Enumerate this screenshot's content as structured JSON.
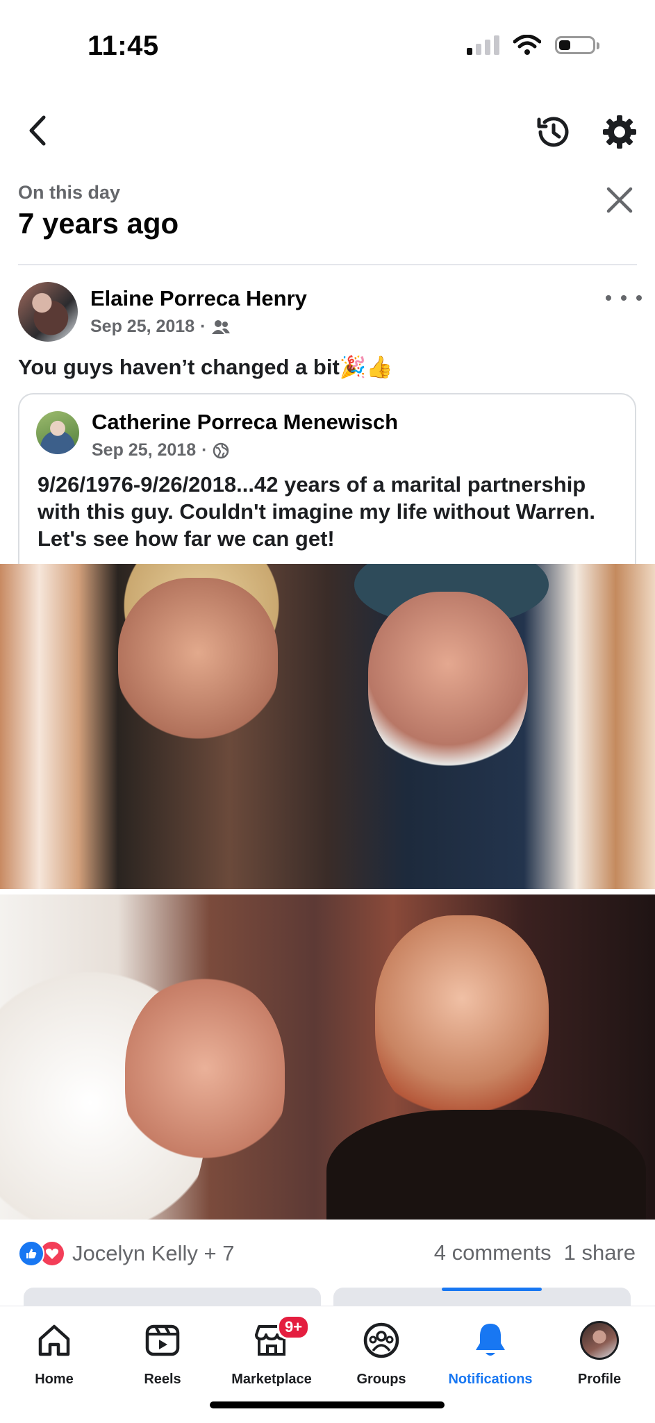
{
  "status_bar": {
    "time": "11:45"
  },
  "memory": {
    "label": "On this day",
    "title": "7 years ago"
  },
  "post": {
    "author": "Elaine Porreca Henry",
    "date": "Sep 25, 2018",
    "separator": "·",
    "audience_icon": "friends-icon",
    "text": "You guys haven’t changed a bit🎉👍"
  },
  "shared_post": {
    "author": "Catherine Porreca Menewisch",
    "date": "Sep 25, 2018",
    "separator": "·",
    "audience_icon": "globe-icon",
    "text": "9/26/1976-9/26/2018...42 years of a marital partnership with this guy. Couldn't imagine my life without Warren. Let's see how far we can get!"
  },
  "engagement": {
    "reactors": "Jocelyn Kelly + 7",
    "comments": "4 comments",
    "shares": "1 share"
  },
  "tabs": [
    {
      "label": "Home",
      "icon": "home-icon"
    },
    {
      "label": "Reels",
      "icon": "reels-icon"
    },
    {
      "label": "Marketplace",
      "icon": "marketplace-icon",
      "badge": "9+"
    },
    {
      "label": "Groups",
      "icon": "groups-icon"
    },
    {
      "label": "Notifications",
      "icon": "bell-icon",
      "active": true
    },
    {
      "label": "Profile",
      "icon": "profile-avatar"
    }
  ],
  "colors": {
    "accent": "#1877f2",
    "badge": "#e41e3f",
    "love": "#f33e58",
    "secondary_text": "#65676b"
  }
}
